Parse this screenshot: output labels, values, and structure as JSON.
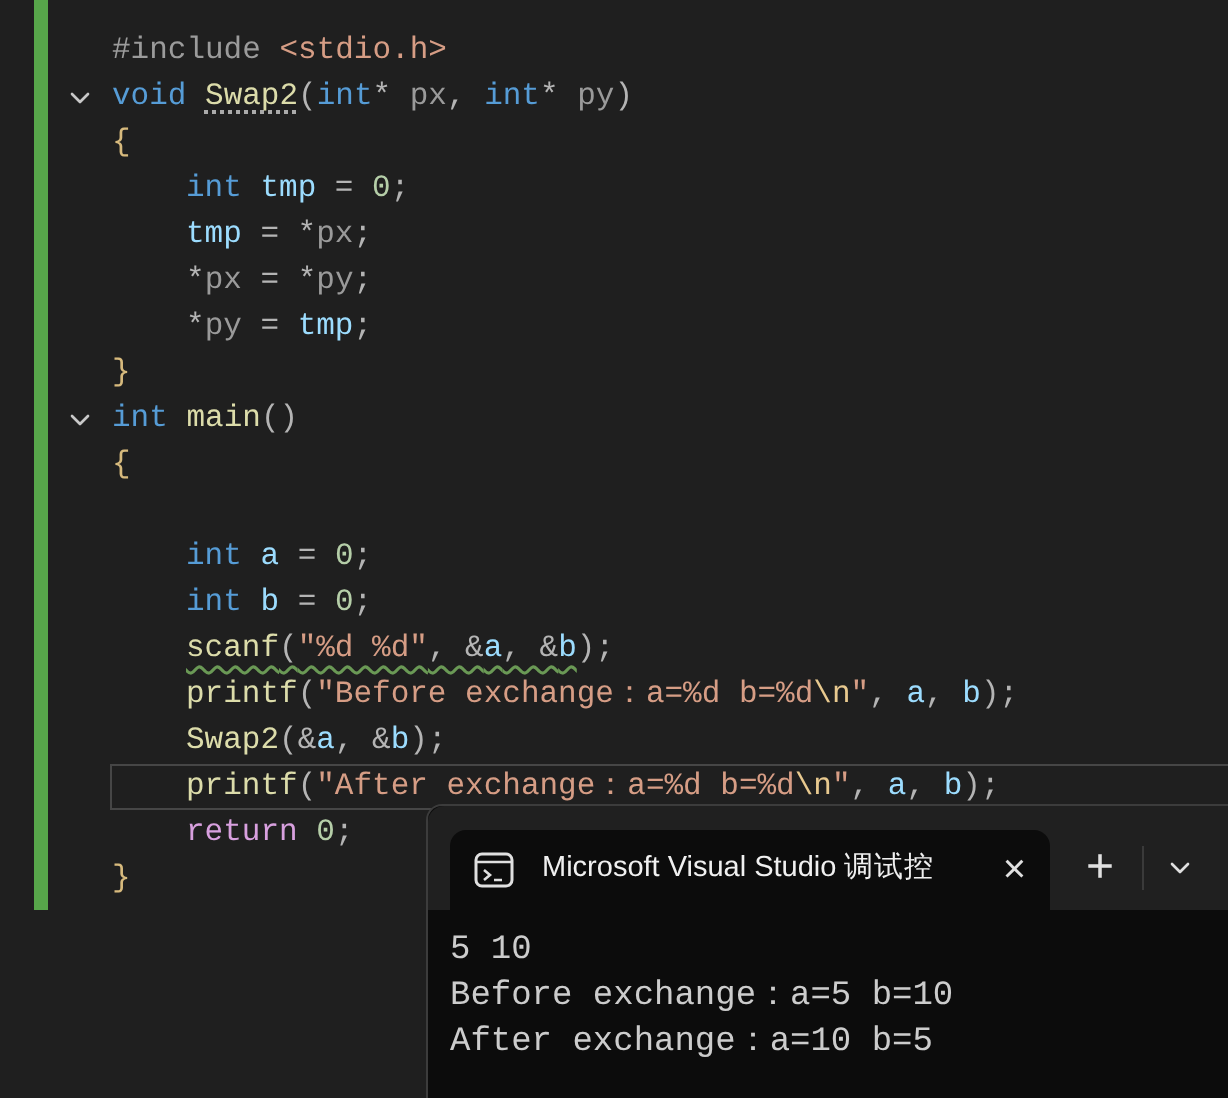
{
  "editor": {
    "lines": [
      {
        "tokens": [
          {
            "kind": "preproc",
            "text": "#include"
          },
          {
            "kind": "string",
            "text": " <stdio.h>"
          }
        ]
      },
      {
        "fold": {
          "expanded": true
        },
        "tokens": [
          {
            "kind": "keyword",
            "text": "void "
          },
          {
            "kind": "func",
            "text": "Swap2",
            "dotted": true
          },
          {
            "kind": "punct",
            "text": "("
          },
          {
            "kind": "keyword",
            "text": "int"
          },
          {
            "kind": "punct",
            "text": "* "
          },
          {
            "kind": "param",
            "text": "px"
          },
          {
            "kind": "punct",
            "text": ", "
          },
          {
            "kind": "keyword",
            "text": "int"
          },
          {
            "kind": "punct",
            "text": "* "
          },
          {
            "kind": "param",
            "text": "py"
          },
          {
            "kind": "punct",
            "text": ")"
          }
        ]
      },
      {
        "tokens": [
          {
            "kind": "brace",
            "text": "{"
          }
        ]
      },
      {
        "indented": true,
        "tokens": [
          {
            "kind": "keyword",
            "text": "int "
          },
          {
            "kind": "var",
            "text": "tmp"
          },
          {
            "kind": "punct",
            "text": " = "
          },
          {
            "kind": "number",
            "text": "0"
          },
          {
            "kind": "punct",
            "text": ";"
          }
        ]
      },
      {
        "indented": true,
        "tokens": [
          {
            "kind": "var",
            "text": "tmp"
          },
          {
            "kind": "punct",
            "text": " = *"
          },
          {
            "kind": "param",
            "text": "px"
          },
          {
            "kind": "punct",
            "text": ";"
          }
        ]
      },
      {
        "indented": true,
        "tokens": [
          {
            "kind": "punct",
            "text": "*"
          },
          {
            "kind": "param",
            "text": "px"
          },
          {
            "kind": "punct",
            "text": " = *"
          },
          {
            "kind": "param",
            "text": "py"
          },
          {
            "kind": "punct",
            "text": ";"
          }
        ]
      },
      {
        "indented": true,
        "tokens": [
          {
            "kind": "punct",
            "text": "*"
          },
          {
            "kind": "param",
            "text": "py"
          },
          {
            "kind": "punct",
            "text": " = "
          },
          {
            "kind": "var",
            "text": "tmp"
          },
          {
            "kind": "punct",
            "text": ";"
          }
        ]
      },
      {
        "tokens": [
          {
            "kind": "brace",
            "text": "}"
          }
        ]
      },
      {
        "fold": {
          "expanded": true
        },
        "tokens": [
          {
            "kind": "keyword",
            "text": "int "
          },
          {
            "kind": "func",
            "text": "main"
          },
          {
            "kind": "punct",
            "text": "()"
          }
        ]
      },
      {
        "tokens": [
          {
            "kind": "brace",
            "text": "{"
          }
        ]
      },
      {
        "blank_line_before": true,
        "indented": true,
        "tokens": [
          {
            "kind": "keyword",
            "text": "int "
          },
          {
            "kind": "var",
            "text": "a"
          },
          {
            "kind": "punct",
            "text": " = "
          },
          {
            "kind": "number",
            "text": "0"
          },
          {
            "kind": "punct",
            "text": ";"
          }
        ]
      },
      {
        "indented": true,
        "tokens": [
          {
            "kind": "keyword",
            "text": "int "
          },
          {
            "kind": "var",
            "text": "b"
          },
          {
            "kind": "punct",
            "text": " = "
          },
          {
            "kind": "number",
            "text": "0"
          },
          {
            "kind": "punct",
            "text": ";"
          }
        ]
      },
      {
        "indented": true,
        "tokens": [
          {
            "kind": "func",
            "text": "scanf",
            "squiggle": true
          },
          {
            "kind": "punct",
            "text": "(",
            "squiggle": true
          },
          {
            "kind": "string",
            "text": "\"%d %d\"",
            "squiggle": true
          },
          {
            "kind": "punct",
            "text": ", &",
            "squiggle": true
          },
          {
            "kind": "var",
            "text": "a",
            "squiggle": true
          },
          {
            "kind": "punct",
            "text": ", &",
            "squiggle": true
          },
          {
            "kind": "var",
            "text": "b",
            "squiggle": true
          },
          {
            "kind": "punct",
            "text": ");"
          }
        ]
      },
      {
        "indented": true,
        "tokens": [
          {
            "kind": "func",
            "text": "printf"
          },
          {
            "kind": "punct",
            "text": "("
          },
          {
            "kind": "string",
            "text": "\"Before exchange：a=%d b=%d"
          },
          {
            "kind": "escape",
            "text": "\\n"
          },
          {
            "kind": "string",
            "text": "\""
          },
          {
            "kind": "punct",
            "text": ", "
          },
          {
            "kind": "var",
            "text": "a"
          },
          {
            "kind": "punct",
            "text": ", "
          },
          {
            "kind": "var",
            "text": "b"
          },
          {
            "kind": "punct",
            "text": ");"
          }
        ]
      },
      {
        "indented": true,
        "tokens": [
          {
            "kind": "func",
            "text": "Swap2"
          },
          {
            "kind": "punct",
            "text": "(&"
          },
          {
            "kind": "var",
            "text": "a"
          },
          {
            "kind": "punct",
            "text": ", &"
          },
          {
            "kind": "var",
            "text": "b"
          },
          {
            "kind": "punct",
            "text": ");"
          }
        ]
      },
      {
        "indented": true,
        "current": true,
        "tokens": [
          {
            "kind": "func",
            "text": "printf"
          },
          {
            "kind": "punct",
            "text": "("
          },
          {
            "kind": "string",
            "text": "\"After exchange：a=%d b=%d"
          },
          {
            "kind": "escape",
            "text": "\\n"
          },
          {
            "kind": "string",
            "text": "\""
          },
          {
            "kind": "punct",
            "text": ", "
          },
          {
            "kind": "var",
            "text": "a"
          },
          {
            "kind": "punct",
            "text": ", "
          },
          {
            "kind": "var",
            "text": "b"
          },
          {
            "kind": "punct",
            "text": ");"
          }
        ]
      },
      {
        "indented": true,
        "tokens": [
          {
            "kind": "control",
            "text": "return "
          },
          {
            "kind": "number",
            "text": "0"
          },
          {
            "kind": "punct",
            "text": ";"
          }
        ]
      },
      {
        "tokens": [
          {
            "kind": "brace",
            "text": "}"
          }
        ]
      }
    ]
  },
  "console": {
    "tab_title": "Microsoft Visual Studio 调试控",
    "close": "×",
    "new_tab": "+",
    "output": [
      "5 10",
      "Before exchange：a=5 b=10",
      "After exchange：a=10 b=5"
    ]
  }
}
